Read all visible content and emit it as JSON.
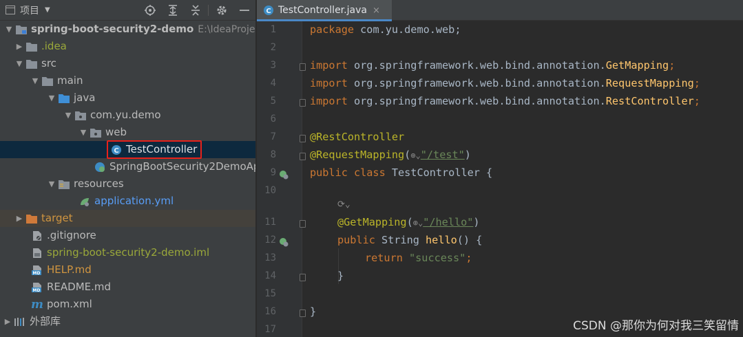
{
  "project_panel": {
    "title": "项目",
    "tree": [
      {
        "label": "spring-boot-security2-demo",
        "path": "E:\\IdeaProject"
      },
      {
        "label": ".idea"
      },
      {
        "label": "src"
      },
      {
        "label": "main"
      },
      {
        "label": "java"
      },
      {
        "label": "com.yu.demo"
      },
      {
        "label": "web"
      },
      {
        "label": "TestController"
      },
      {
        "label": "SpringBootSecurity2DemoAp"
      },
      {
        "label": "resources"
      },
      {
        "label": "application.yml"
      },
      {
        "label": "target"
      },
      {
        "label": ".gitignore"
      },
      {
        "label": "spring-boot-security2-demo.iml"
      },
      {
        "label": "HELP.md"
      },
      {
        "label": "README.md"
      },
      {
        "label": "pom.xml"
      },
      {
        "label": "外部库"
      }
    ]
  },
  "editor": {
    "tab": {
      "label": "TestController.java",
      "close": "×"
    },
    "line_numbers": [
      "1",
      "2",
      "3",
      "4",
      "5",
      "6",
      "7",
      "8",
      "9",
      "10",
      "11",
      "12",
      "13",
      "14",
      "15",
      "16",
      "17"
    ],
    "code": {
      "l1_kw": "package",
      "l1_rest": " com.yu.demo.web;",
      "l3_kw": "import",
      "l3_pkg": " org.springframework.web.bind.annotation.",
      "l3_cls": "GetMapping",
      "l4_kw": "import",
      "l4_pkg": " org.springframework.web.bind.annotation.",
      "l4_cls": "RequestMapping",
      "l5_kw": "import",
      "l5_pkg": " org.springframework.web.bind.annotation.",
      "l5_cls": "RestController",
      "l7_ann": "@RestController",
      "l8_ann": "@RequestMapping",
      "l8_open": "(",
      "l8_str": "\"/test\"",
      "l8_close": ")",
      "l9_kw": "public class",
      "l9_rest": " TestController {",
      "l11_ann": "@GetMapping",
      "l11_open": "(",
      "l11_str": "\"/hello\"",
      "l11_close": ")",
      "l12_kw": "public",
      "l12_type": " String ",
      "l12_fn": "hello",
      "l12_rest": "() {",
      "l13_kw": "return",
      "l13_str": " \"success\"",
      "l13_end": ";",
      "l14": "}",
      "l16": "}"
    },
    "colors": {
      "keyword": "#cc7832",
      "annotation": "#bbb529",
      "string": "#6a8759",
      "function": "#ffc66d",
      "selection_highlight": "#e8211a"
    }
  },
  "watermark": "CSDN @那你为何对我三笑留情"
}
